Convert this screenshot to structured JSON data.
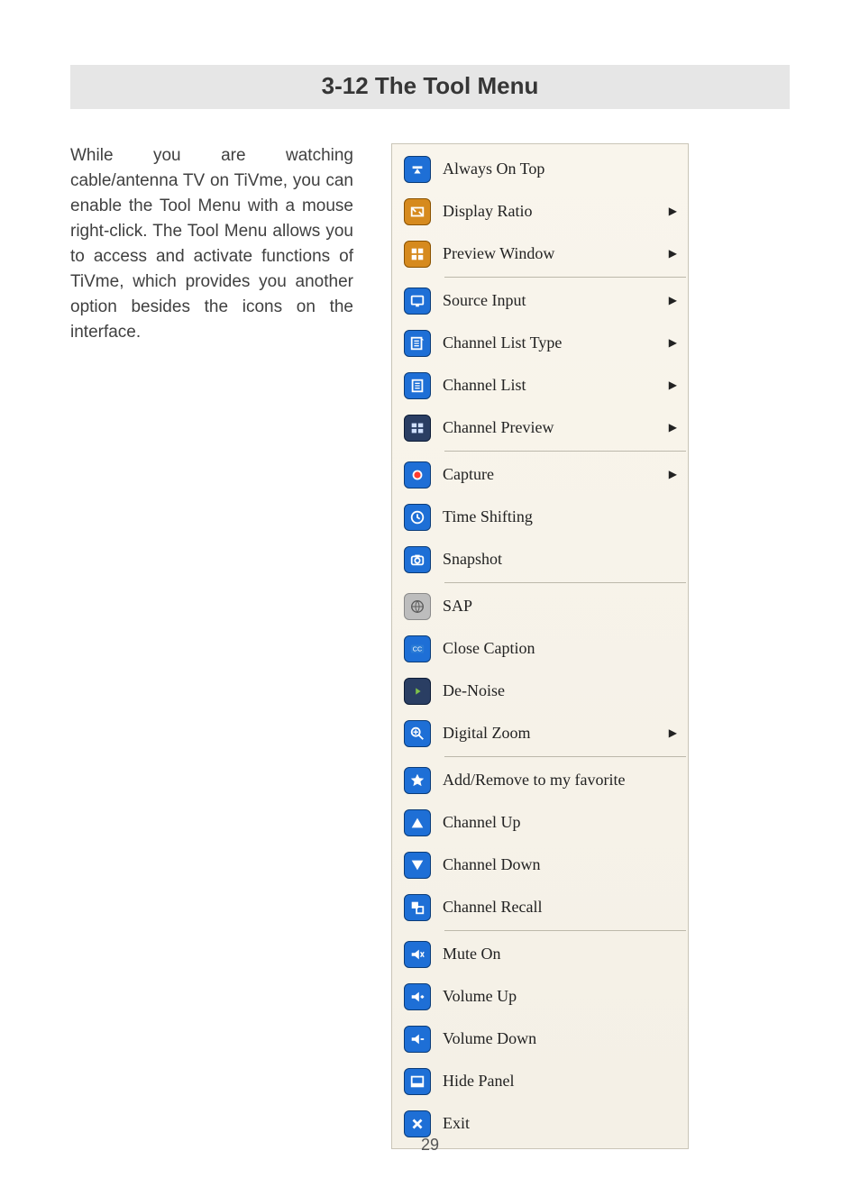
{
  "title": "3-12 The Tool Menu",
  "intro": "While you are watching cable/antenna TV on TiVme, you can enable the Tool Menu with a mouse right-click. The Tool Menu allows you to access and activate functions of TiVme, which provides you another option besides the icons on the interface.",
  "page_number": "29",
  "menu": {
    "groups": [
      [
        {
          "name": "always-on-top",
          "label": "Always On Top",
          "icon": "pin-down-icon",
          "color": "blue",
          "submenu": false
        },
        {
          "name": "display-ratio",
          "label": "Display Ratio",
          "icon": "ratio-icon",
          "color": "orange",
          "submenu": true
        },
        {
          "name": "preview-window",
          "label": "Preview Window",
          "icon": "grid-icon",
          "color": "orange",
          "submenu": true
        }
      ],
      [
        {
          "name": "source-input",
          "label": "Source Input",
          "icon": "monitor-icon",
          "color": "blue",
          "submenu": true
        },
        {
          "name": "channel-list-type",
          "label": "Channel List Type",
          "icon": "list-type-icon",
          "color": "blue",
          "submenu": true
        },
        {
          "name": "channel-list",
          "label": "Channel List",
          "icon": "list-icon",
          "color": "blue",
          "submenu": true
        },
        {
          "name": "channel-preview",
          "label": "Channel Preview",
          "icon": "preview-grid-icon",
          "color": "navy",
          "submenu": true
        }
      ],
      [
        {
          "name": "capture",
          "label": "Capture",
          "icon": "record-icon",
          "color": "blue",
          "submenu": true
        },
        {
          "name": "time-shifting",
          "label": "Time Shifting",
          "icon": "clock-icon",
          "color": "blue",
          "submenu": false
        },
        {
          "name": "snapshot",
          "label": "Snapshot",
          "icon": "camera-icon",
          "color": "blue",
          "submenu": false
        }
      ],
      [
        {
          "name": "sap",
          "label": "SAP",
          "icon": "globe-icon",
          "color": "gray",
          "submenu": false
        },
        {
          "name": "close-caption",
          "label": "Close Caption",
          "icon": "cc-icon",
          "color": "blue",
          "submenu": false
        },
        {
          "name": "de-noise",
          "label": "De-Noise",
          "icon": "denoise-icon",
          "color": "navy",
          "submenu": false
        },
        {
          "name": "digital-zoom",
          "label": "Digital Zoom",
          "icon": "zoom-icon",
          "color": "blue",
          "submenu": true
        }
      ],
      [
        {
          "name": "add-remove-favorite",
          "label": "Add/Remove to my favorite",
          "icon": "star-icon",
          "color": "blue",
          "submenu": false
        },
        {
          "name": "channel-up",
          "label": "Channel Up",
          "icon": "triangle-up-icon",
          "color": "blue",
          "submenu": false
        },
        {
          "name": "channel-down",
          "label": "Channel Down",
          "icon": "triangle-down-icon",
          "color": "blue",
          "submenu": false
        },
        {
          "name": "channel-recall",
          "label": "Channel Recall",
          "icon": "recall-icon",
          "color": "blue",
          "submenu": false
        }
      ],
      [
        {
          "name": "mute-on",
          "label": "Mute On",
          "icon": "mute-icon",
          "color": "blue",
          "submenu": false
        },
        {
          "name": "volume-up",
          "label": "Volume Up",
          "icon": "volume-up-icon",
          "color": "blue",
          "submenu": false
        },
        {
          "name": "volume-down",
          "label": "Volume Down",
          "icon": "volume-down-icon",
          "color": "blue",
          "submenu": false
        },
        {
          "name": "hide-panel",
          "label": "Hide Panel",
          "icon": "panel-icon",
          "color": "blue",
          "submenu": false
        },
        {
          "name": "exit",
          "label": "Exit",
          "icon": "close-icon",
          "color": "blue",
          "submenu": false
        }
      ]
    ]
  }
}
